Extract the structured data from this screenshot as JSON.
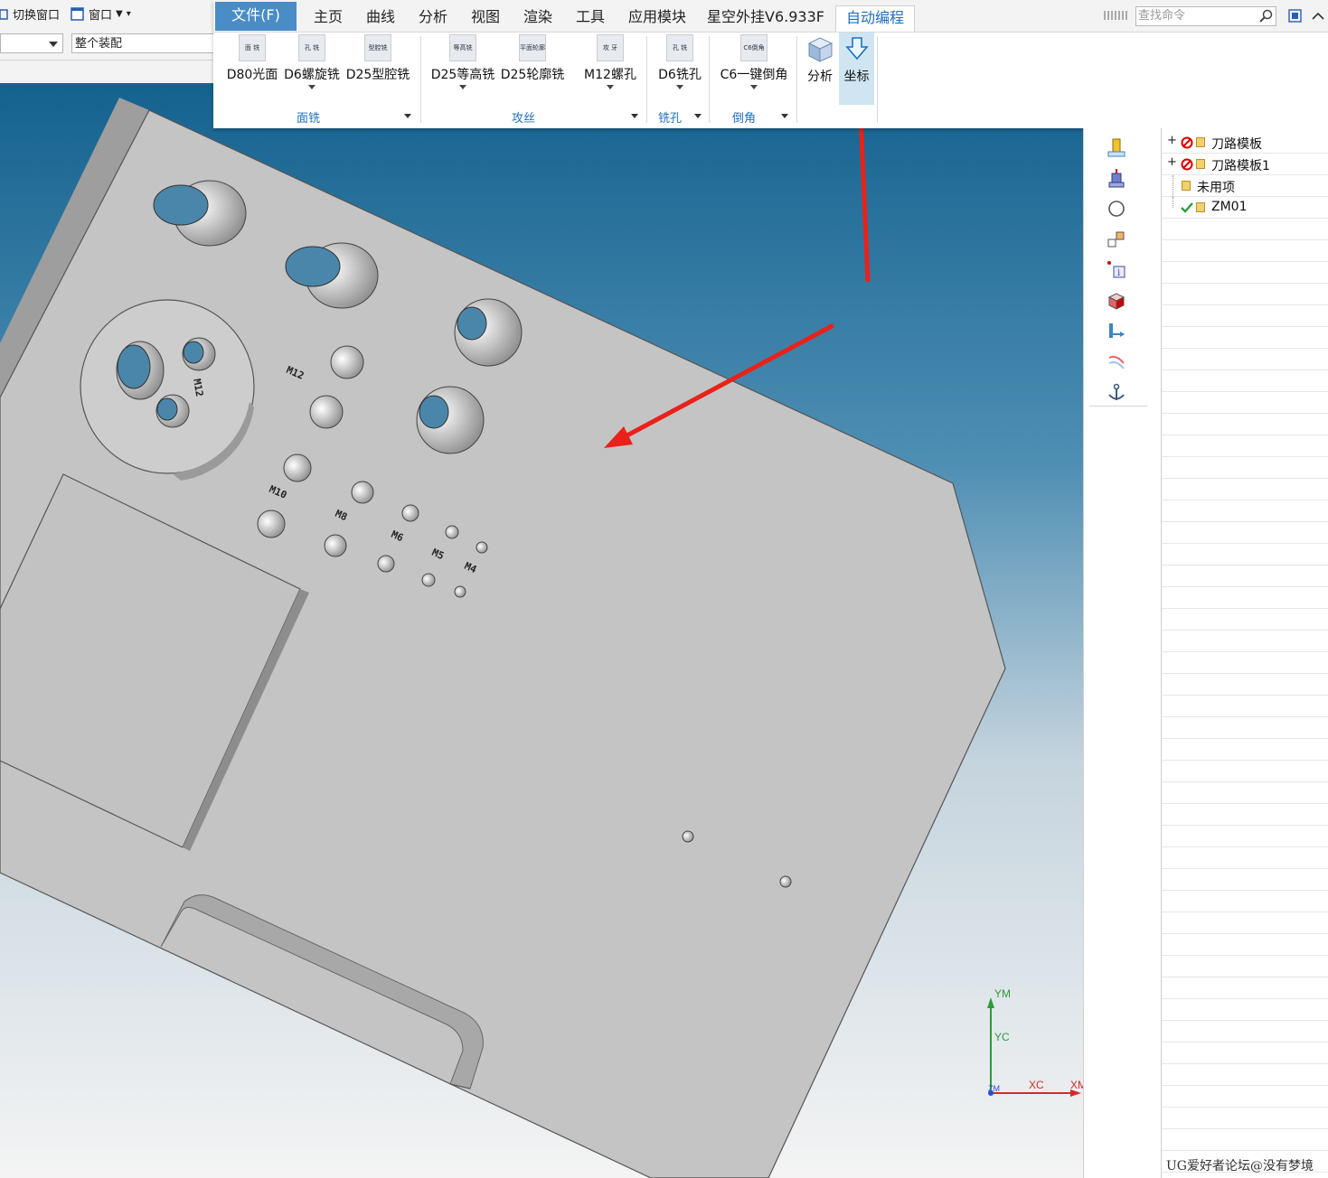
{
  "topleft": {
    "switch_window": "切换窗口",
    "window_menu": "窗口",
    "dropdown1_value": "",
    "dropdown2_value": "整个装配"
  },
  "ribbon": {
    "tabs": [
      "文件(F)",
      "主页",
      "曲线",
      "分析",
      "视图",
      "渲染",
      "工具",
      "应用模块",
      "星空外挂V6.933F",
      "自动编程"
    ],
    "active_tab": "自动编程",
    "search_placeholder": "查找命令",
    "buttons": [
      {
        "label": "D80光面",
        "icon_text": "面 铣"
      },
      {
        "label": "D6螺旋铣",
        "icon_text": "孔 铣"
      },
      {
        "label": "D25型腔铣",
        "icon_text": "型腔铣"
      },
      {
        "label": "D25等高铣",
        "icon_text": "等高铣"
      },
      {
        "label": "D25轮廓铣",
        "icon_text": "平面轮廓"
      },
      {
        "label": "M12螺孔",
        "icon_text": "攻 牙"
      },
      {
        "label": "D6铣孔",
        "icon_text": "孔 铣"
      },
      {
        "label": "C6一键倒角",
        "icon_text": "C6倒角"
      },
      {
        "label": "分析",
        "icon_text": ""
      },
      {
        "label": "坐标",
        "icon_text": ""
      }
    ],
    "groups": [
      "面铣",
      "攻丝",
      "铣孔",
      "倒角"
    ]
  },
  "model": {
    "labels": [
      "M12",
      "M12",
      "M10",
      "M8",
      "M6",
      "M5",
      "M4"
    ]
  },
  "triad": {
    "ym": "YM",
    "yc": "YC",
    "xc": "XC",
    "xm": "XM",
    "zm": "ZM"
  },
  "navigator": {
    "rows": [
      {
        "label": "刀路模板",
        "status": "excluded",
        "expand": "+"
      },
      {
        "label": "刀路模板1",
        "status": "excluded",
        "expand": "+"
      },
      {
        "label": "未用项",
        "status": "none",
        "expand": ""
      },
      {
        "label": "ZM01",
        "status": "ok",
        "expand": ""
      }
    ]
  },
  "watermark": "UG爱好者论坛@没有梦境",
  "colors": {
    "accent": "#1f6fbf",
    "file_tab": "#4a8cc6",
    "bg_top": "#1a6a9a",
    "part": "#c4c4c4",
    "arrow": "#e8221a"
  }
}
